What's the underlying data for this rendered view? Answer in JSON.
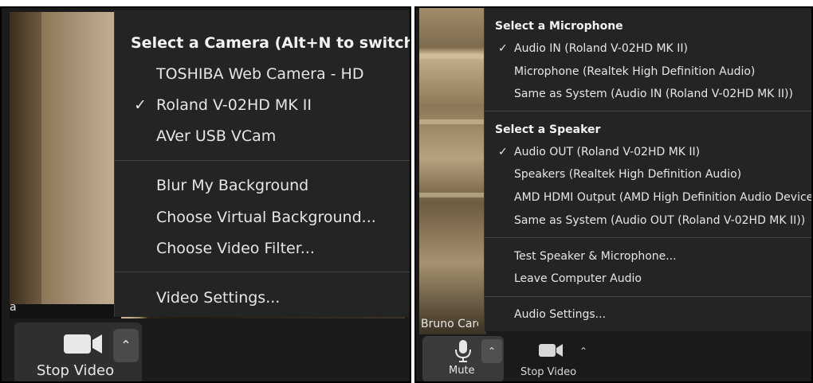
{
  "camera_menu": {
    "header": "Select a Camera (Alt+N to switch)",
    "cameras": [
      {
        "label": "TOSHIBA Web Camera - HD",
        "selected": false
      },
      {
        "label": "Roland V-02HD MK II",
        "selected": true
      },
      {
        "label": "AVer USB VCam",
        "selected": false
      }
    ],
    "options": [
      "Blur My Background",
      "Choose Virtual Background...",
      "Choose Video Filter..."
    ],
    "settings": "Video Settings..."
  },
  "left_toolbar": {
    "stop_video_label": "Stop Video",
    "name_fragment": "a"
  },
  "audio_menu": {
    "mic_header": "Select a Microphone",
    "microphones": [
      {
        "label": "Audio IN (Roland V-02HD MK II)",
        "selected": true
      },
      {
        "label": "Microphone (Realtek High Definition Audio)",
        "selected": false
      },
      {
        "label": "Same as System (Audio IN (Roland V-02HD MK II))",
        "selected": false
      }
    ],
    "speaker_header": "Select a Speaker",
    "speakers": [
      {
        "label": "Audio OUT (Roland V-02HD MK II)",
        "selected": true
      },
      {
        "label": "Speakers (Realtek High Definition Audio)",
        "selected": false
      },
      {
        "label": "AMD HDMI Output (AMD High Definition Audio Device)",
        "selected": false
      },
      {
        "label": "Same as System (Audio OUT (Roland V-02HD MK II))",
        "selected": false
      }
    ],
    "actions": [
      "Test Speaker & Microphone...",
      "Leave Computer Audio"
    ],
    "settings": "Audio Settings..."
  },
  "right_toolbar": {
    "participant_name": "Bruno Carc",
    "mute_label": "Mute",
    "stop_video_label": "Stop Video"
  },
  "icons": {
    "check": "check-icon",
    "chevron": "chevron-up-icon",
    "camera": "video-camera-icon",
    "microphone": "microphone-icon"
  },
  "colors": {
    "menu_bg": "#242424",
    "menu_text": "#e6e6e6",
    "separator": "#454545",
    "button_bg": "#2f2f2f"
  }
}
